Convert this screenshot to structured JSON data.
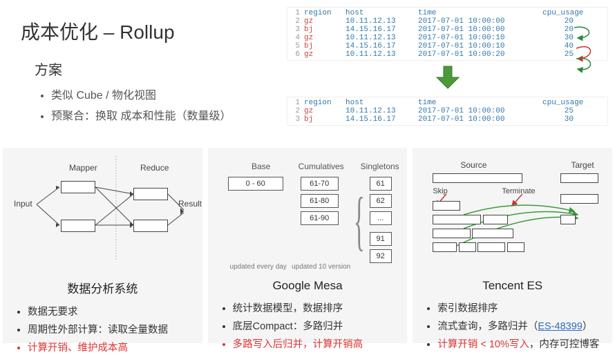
{
  "title": "成本优化 – Rollup",
  "subtitle": "方案",
  "intro_bullets": [
    "类似 Cube / 物化视图",
    "预聚合：换取 成本和性能（数量级）"
  ],
  "table_top": {
    "headers": [
      "region",
      "host",
      "time",
      "cpu_usage"
    ],
    "rows": [
      [
        "1",
        "region",
        "host",
        "time",
        "cpu_usage"
      ],
      [
        "2",
        "gz",
        "10.11.12.13",
        "2017-07-01 10:00:00",
        "20"
      ],
      [
        "3",
        "bj",
        "14.15.16.17",
        "2017-07-01 10:00:00",
        "20"
      ],
      [
        "4",
        "gz",
        "10.11.12.13",
        "2017-07-01 10:00:10",
        "30"
      ],
      [
        "5",
        "bj",
        "14.15.16.17",
        "2017-07-01 10:00:10",
        "40"
      ],
      [
        "6",
        "gz",
        "10.11.12.13",
        "2017-07-01 10:00:20",
        "25"
      ]
    ]
  },
  "table_bottom": {
    "rows": [
      [
        "1",
        "region",
        "host",
        "time",
        "cpu_usage"
      ],
      [
        "2",
        "gz",
        "10.11.12.13",
        "2017-07-01 10:00:00",
        "25"
      ],
      [
        "3",
        "bj",
        "14.15.16.17",
        "2017-07-01 10:00:00",
        "30"
      ]
    ]
  },
  "panel1": {
    "title": "数据分析系统",
    "labels": {
      "mapper": "Mapper",
      "reduce": "Reduce",
      "input": "Input",
      "result": "Result"
    },
    "bullets": [
      {
        "text": "数据无要求"
      },
      {
        "text": "周期性外部计算：读取全量数据"
      },
      {
        "text": "计算开销、维护成本高",
        "red": true
      }
    ]
  },
  "panel2": {
    "title": "Google Mesa",
    "labels": {
      "base": "Base",
      "cumulatives": "Cumulatives",
      "singletons": "Singletons",
      "base_val": "0 - 60",
      "cum1": "61-70",
      "cum2": "61-80",
      "cum3": "61-90",
      "s1": "61",
      "s2": "62",
      "s3": "...",
      "s4": "91",
      "s5": "92",
      "note_left": "updated every day",
      "note_right": "updated 10 version"
    },
    "bullets": [
      {
        "text": "统计数据模型，数据排序"
      },
      {
        "text": "底层Compact：多路归并"
      },
      {
        "text": "多路写入后归并，计算开销高",
        "red": true
      }
    ]
  },
  "panel3": {
    "title": "Tencent ES",
    "labels": {
      "source": "Source",
      "target": "Target",
      "skip": "Skip",
      "terminate": "Terminate"
    },
    "bullets": [
      {
        "text": "索引数据排序"
      },
      {
        "text_pre": "流式查询，多路归并（",
        "link": "ES-48399",
        "text_post": "）"
      },
      {
        "text_pre": "计算开销 < 10%写入",
        "red": true,
        "tail": "，内存可控博客"
      }
    ]
  }
}
